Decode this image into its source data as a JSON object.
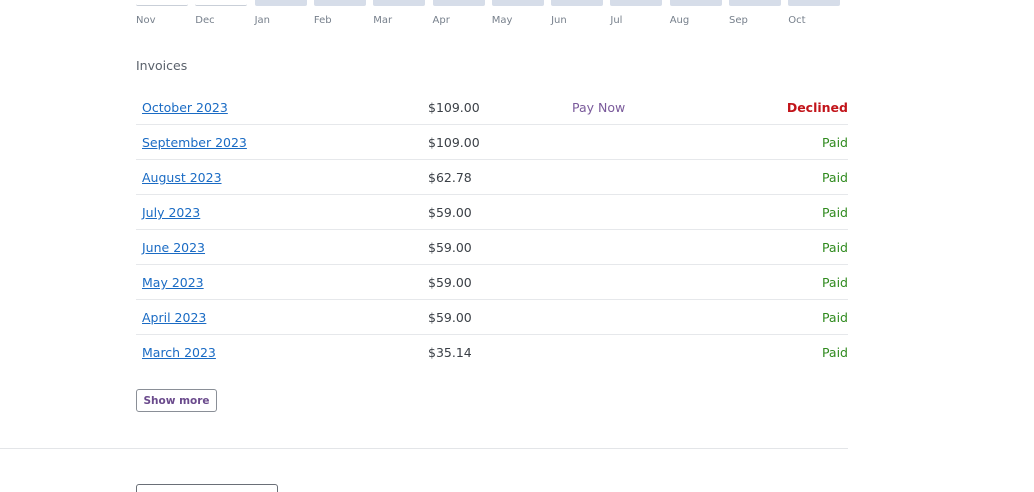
{
  "chart": {
    "months": [
      {
        "label": "Nov",
        "outline": true
      },
      {
        "label": "Dec",
        "outline": true
      },
      {
        "label": "Jan",
        "outline": false
      },
      {
        "label": "Feb",
        "outline": false
      },
      {
        "label": "Mar",
        "outline": false
      },
      {
        "label": "Apr",
        "outline": false
      },
      {
        "label": "May",
        "outline": false
      },
      {
        "label": "Jun",
        "outline": false
      },
      {
        "label": "Jul",
        "outline": false
      },
      {
        "label": "Aug",
        "outline": false
      },
      {
        "label": "Sep",
        "outline": false
      },
      {
        "label": "Oct",
        "outline": false
      }
    ],
    "bar_color": "#d6dde9"
  },
  "invoices": {
    "title": "Invoices",
    "rows": [
      {
        "month": "October 2023",
        "amount": "$109.00",
        "action": "Pay Now",
        "status": "Declined",
        "status_type": "declined"
      },
      {
        "month": "September 2023",
        "amount": "$109.00",
        "action": "",
        "status": "Paid",
        "status_type": "paid"
      },
      {
        "month": "August 2023",
        "amount": "$62.78",
        "action": "",
        "status": "Paid",
        "status_type": "paid"
      },
      {
        "month": "July 2023",
        "amount": "$59.00",
        "action": "",
        "status": "Paid",
        "status_type": "paid"
      },
      {
        "month": "June 2023",
        "amount": "$59.00",
        "action": "",
        "status": "Paid",
        "status_type": "paid"
      },
      {
        "month": "May 2023",
        "amount": "$59.00",
        "action": "",
        "status": "Paid",
        "status_type": "paid"
      },
      {
        "month": "April 2023",
        "amount": "$59.00",
        "action": "",
        "status": "Paid",
        "status_type": "paid"
      },
      {
        "month": "March 2023",
        "amount": "$35.14",
        "action": "",
        "status": "Paid",
        "status_type": "paid"
      }
    ],
    "show_more_label": "Show more"
  },
  "colors": {
    "link": "#1a6bc4",
    "paid": "#2f8a1e",
    "declined": "#c2141a",
    "action": "#7a5a9b"
  }
}
